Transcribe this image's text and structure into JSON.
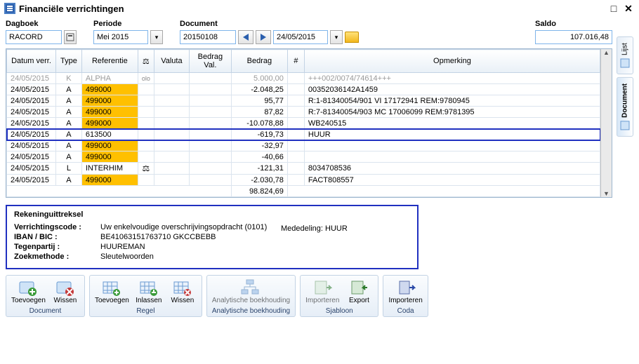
{
  "window": {
    "title": "Financiële verrichtingen"
  },
  "filters": {
    "dagboek_label": "Dagboek",
    "dagboek_value": "RACORD",
    "periode_label": "Periode",
    "periode_value": "Mei 2015",
    "document_label": "Document",
    "document_value": "20150108",
    "date_value": "24/05/2015",
    "saldo_label": "Saldo",
    "saldo_value": "107.016,48"
  },
  "grid": {
    "columns": {
      "datum": "Datum verr.",
      "type": "Type",
      "referentie": "Referentie",
      "valuta": "Valuta",
      "bedrag_val": "Bedrag Val.",
      "bedrag": "Bedrag",
      "hash": "#",
      "opmerking": "Opmerking"
    },
    "rows": [
      {
        "datum": "24/05/2015",
        "type": "K",
        "ref": "ALPHA",
        "ref_hi": false,
        "ico": "olo",
        "bedrag": "5.000,00",
        "opm": "+++002/0074/74614+++",
        "faded": true
      },
      {
        "datum": "24/05/2015",
        "type": "A",
        "ref": "499000",
        "ref_hi": true,
        "bedrag": "-2.048,25",
        "opm": "00352036142A1459"
      },
      {
        "datum": "24/05/2015",
        "type": "A",
        "ref": "499000",
        "ref_hi": true,
        "bedrag": "95,77",
        "opm": "R:1-81340054/901 VI 17172941 REM:9780945"
      },
      {
        "datum": "24/05/2015",
        "type": "A",
        "ref": "499000",
        "ref_hi": true,
        "bedrag": "87,82",
        "opm": "R:7-81340054/903 MC 17006099 REM:9781395"
      },
      {
        "datum": "24/05/2015",
        "type": "A",
        "ref": "499000",
        "ref_hi": true,
        "bedrag": "-10.078,88",
        "opm": "WB240515"
      },
      {
        "datum": "24/05/2015",
        "type": "A",
        "ref": "613500",
        "ref_hi": false,
        "bedrag": "-619,73",
        "opm": "HUUR",
        "selected": true
      },
      {
        "datum": "24/05/2015",
        "type": "A",
        "ref": "499000",
        "ref_hi": true,
        "bedrag": "-32,97",
        "opm": ""
      },
      {
        "datum": "24/05/2015",
        "type": "A",
        "ref": "499000",
        "ref_hi": true,
        "bedrag": "-40,66",
        "opm": ""
      },
      {
        "datum": "24/05/2015",
        "type": "L",
        "ref": "INTERHIM",
        "ref_hi": false,
        "ico": "balance",
        "bedrag": "-121,31",
        "opm": "8034708536"
      },
      {
        "datum": "24/05/2015",
        "type": "A",
        "ref": "499000",
        "ref_hi": true,
        "bedrag": "-2.030,78",
        "opm": "FACT808557"
      }
    ],
    "total_bedrag": "98.824,69"
  },
  "detail": {
    "title": "Rekeninguittreksel",
    "verrichtingscode_label": "Verrichtingscode :",
    "verrichtingscode_value": "Uw enkelvoudige overschrijvingsopdracht (0101)",
    "mededeling_label": "Mededeling:",
    "mededeling_value": "HUUR",
    "iban_label": "IBAN / BIC :",
    "iban_value": "BE41063151763710 GKCCBEBB",
    "tegenpartij_label": "Tegenpartij :",
    "tegenpartij_value": "HUUREMAN",
    "zoekmethode_label": "Zoekmethode :",
    "zoekmethode_value": "Sleutelwoorden"
  },
  "toolbar": {
    "groups": [
      {
        "title": "Document",
        "buttons": [
          {
            "name": "doc-add",
            "label": "Toevoegen",
            "kind": "add"
          },
          {
            "name": "doc-del",
            "label": "Wissen",
            "kind": "del"
          }
        ]
      },
      {
        "title": "Regel",
        "buttons": [
          {
            "name": "row-add",
            "label": "Toevoegen",
            "kind": "grid-add"
          },
          {
            "name": "row-ins",
            "label": "Inlassen",
            "kind": "grid-ins"
          },
          {
            "name": "row-del",
            "label": "Wissen",
            "kind": "grid-del"
          }
        ]
      },
      {
        "title": "Analytische boekhouding",
        "buttons": [
          {
            "name": "analytic",
            "label": "Analytische boekhouding",
            "kind": "tree",
            "disabled": true
          }
        ]
      },
      {
        "title": "Sjabloon",
        "buttons": [
          {
            "name": "tpl-import",
            "label": "Importeren",
            "kind": "import-tpl",
            "disabled": true
          },
          {
            "name": "tpl-export",
            "label": "Export",
            "kind": "export-tpl"
          }
        ]
      },
      {
        "title": "Coda",
        "buttons": [
          {
            "name": "coda-import",
            "label": "Importeren",
            "kind": "import-coda"
          }
        ]
      }
    ]
  },
  "side_tabs": [
    {
      "name": "tab-lijst",
      "label": "Lijst",
      "active": false
    },
    {
      "name": "tab-document",
      "label": "Document",
      "active": true
    }
  ]
}
